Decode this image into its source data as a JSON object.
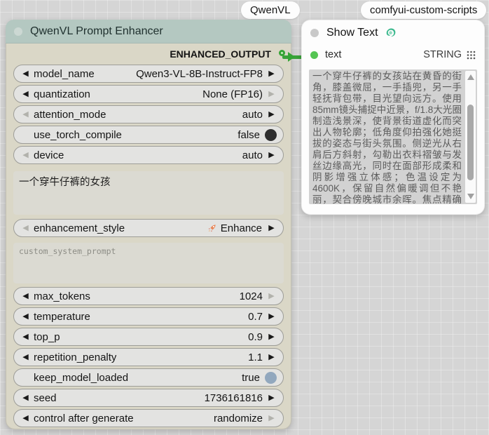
{
  "badges": {
    "enhancer_pack": "QwenVL",
    "showtext_pack": "comfyui-custom-scripts"
  },
  "enhancer_node": {
    "title": "QwenVL Prompt Enhancer",
    "output_label": "ENHANCED_OUTPUT",
    "widgets": [
      {
        "name": "model_name",
        "value": "Qwen3-VL-8B-Instruct-FP8"
      },
      {
        "name": "quantization",
        "value": "None (FP16)"
      },
      {
        "name": "attention_mode",
        "value": "auto"
      },
      {
        "name": "use_torch_compile",
        "value": "false"
      },
      {
        "name": "device",
        "value": "auto"
      },
      {
        "name": "enhancement_style",
        "value": "Enhance",
        "icon": "rocket-icon"
      },
      {
        "name": "max_tokens",
        "value": "1024"
      },
      {
        "name": "temperature",
        "value": "0.7"
      },
      {
        "name": "top_p",
        "value": "0.9"
      },
      {
        "name": "repetition_penalty",
        "value": "1.1"
      },
      {
        "name": "keep_model_loaded",
        "value": "true"
      },
      {
        "name": "seed",
        "value": "1736161816"
      },
      {
        "name": "control after generate",
        "value": "randomize"
      }
    ],
    "prompt_text": "一个穿牛仔裤的女孩",
    "custom_prompt_placeholder": "custom_system_prompt"
  },
  "show_text_node": {
    "title": "Show Text",
    "input_label": "text",
    "output_type": "STRING",
    "text_value": "一个穿牛仔裤的女孩站在黄昏的街角，膝盖微屈，一手插兜，另一手轻抚背包带，目光望向远方。使用85mm镜头捕捉中近景，f/1.8大光圈制造浅景深，使背景街道虚化而突出人物轮廓；低角度仰拍强化她挺拔的姿态与街头氛围。侧逆光从右肩后方斜射，勾勒出衣料褶皱与发丝边缘高光，同时在面部形成柔和阴影增强立体感；色温设定为4600K，保留自然偏暖调但不艳丽，契合傍晚城市余晖。焦点精确对准她瞳孔中心，确保眼神锐利清晰。构图上采用三分法，女孩置于右侧黄金分割点，左侧留白延伸街道引导视线，画面底部加入几级台阶增加透视层次，整体强调"
  },
  "colors": {
    "header_teal": "#b4c8c1",
    "node_body_beige": "#dad7c7",
    "accent_green": "#55c553",
    "link_green": "#3aa33a",
    "toggle_true_blue": "#92a8be",
    "toggle_false_dark": "#2e2e2e"
  }
}
